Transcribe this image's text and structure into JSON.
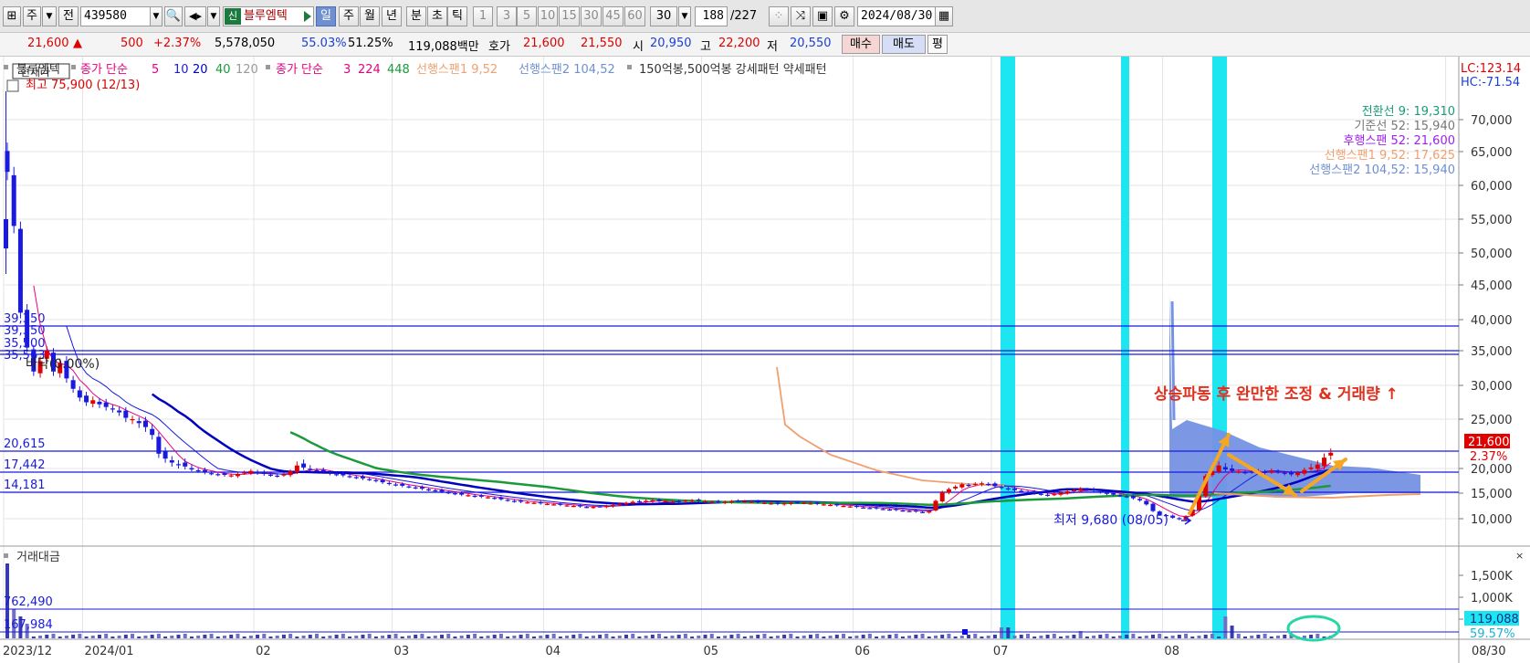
{
  "toolbar": {
    "period_type": "주",
    "prev_label": "전",
    "stock_code": "439580",
    "stock_tag": "신",
    "stock_name": "블루엠텍",
    "periods": [
      "일",
      "주",
      "월",
      "년",
      "분",
      "초",
      "틱"
    ],
    "active_period": "일",
    "intervals": [
      "1",
      "3",
      "5",
      "10",
      "15",
      "30",
      "45",
      "60"
    ],
    "interval_value": "30",
    "count_value": "188",
    "count_total": "/227",
    "date": "2024/08/30"
  },
  "quote": {
    "price": "21,600",
    "arrow": "▲",
    "change": "500",
    "change_pct": "+2.37%",
    "volume": "5,578,050",
    "ratio1": "55.03%",
    "ratio2": "51.25%",
    "amount": "119,088백만",
    "hoga_label": "호가",
    "ask": "21,600",
    "bid": "21,550",
    "open_label": "시",
    "open": "20,950",
    "high_label": "고",
    "high": "22,200",
    "low_label": "저",
    "low": "20,550",
    "buy_label": "매수",
    "sell_label": "매도",
    "eval_label": "평"
  },
  "legend": {
    "name": "블루엠텍",
    "ma_label": "종가 단순",
    "ma_periods": [
      "5",
      "10",
      "20",
      "40",
      "120"
    ],
    "ma2_label": "종가 단순",
    "ma2_periods": [
      "3",
      "224",
      "448"
    ],
    "span1": "선행스팬1 9,52",
    "span2": "선행스팬2 104,52",
    "pattern": "150억봉,500억봉 강세패턴  약세패턴",
    "current_tag": "현재가",
    "max_label": "최고 75,900 (12/13)",
    "lc": "LC:123.14",
    "hc": "HC:-71.54"
  },
  "ichimoku_legend": [
    {
      "text": "전환선 9: 19,310",
      "color": "#1b9a7a"
    },
    {
      "text": "기준선 52: 15,940",
      "color": "#777777"
    },
    {
      "text": "후행스팬 52: 21,600",
      "color": "#a020f0"
    },
    {
      "text": "선행스팬1 9,52: 17,625",
      "color": "#f0a070"
    },
    {
      "text": "선행스팬2 104,52: 15,940",
      "color": "#6f8fd0"
    }
  ],
  "annotations": {
    "main_text": "상승파동 후 완만한 조정 & 거래량 ↑",
    "min_label": "최저 9,680 (08/05)",
    "zero_label": "바닥(0.00%)",
    "current_price": "21,600",
    "current_pct": "2.37%",
    "vol_current": "119,088",
    "vol_pct": "59.57%"
  },
  "h_levels": [
    {
      "value": 39350,
      "label": "39,350",
      "label2": "39,350"
    },
    {
      "value": 35500,
      "label": "35,500",
      "label2": "35,563"
    },
    {
      "value": 20615,
      "label": "20,615"
    },
    {
      "value": 17442,
      "label": "17,442"
    },
    {
      "value": 14181,
      "label": "14,181"
    }
  ],
  "volume_panel": {
    "title": "거래대금",
    "levels": [
      {
        "value": 762490,
        "label": "762,490"
      },
      {
        "value": 167984,
        "label": "167,984"
      }
    ],
    "ticks": [
      "1,500K",
      "1,000K",
      "500K"
    ]
  },
  "chart_data": {
    "type": "candlestick",
    "y_ticks": [
      10000,
      15000,
      20000,
      25000,
      30000,
      35000,
      40000,
      45000,
      50000,
      55000,
      60000,
      65000,
      70000
    ],
    "y_tick_labels": [
      "10,000",
      "15,000",
      "20,000",
      "25,000",
      "30,000",
      "35,000",
      "40,000",
      "45,000",
      "50,000",
      "55,000",
      "60,000",
      "65,000",
      "70,000"
    ],
    "ylim": [
      7500,
      75900
    ],
    "x_labels": [
      {
        "label": "2023/12",
        "index": 0
      },
      {
        "label": "2024/01",
        "index": 12
      },
      {
        "label": "02",
        "index": 38
      },
      {
        "label": "03",
        "index": 59
      },
      {
        "label": "04",
        "index": 82
      },
      {
        "label": "05",
        "index": 106
      },
      {
        "label": "06",
        "index": 129
      },
      {
        "label": "07",
        "index": 150
      },
      {
        "label": "08",
        "index": 176
      },
      {
        "label": "08/30",
        "index": 219
      }
    ],
    "series": [
      {
        "name": "close",
        "values": [
          62000,
          54000,
          41000,
          35500,
          32000,
          33500,
          35000,
          32000,
          33200,
          31000,
          29500,
          28200,
          27500,
          27800,
          27200,
          26800,
          26500,
          26000,
          25200,
          25000,
          24600,
          24200,
          23400,
          21500,
          21000,
          20600,
          20400,
          20200,
          19800,
          19500,
          19200,
          19000,
          18800,
          18700,
          18600,
          18900,
          19200,
          19500,
          19100,
          18900,
          18700,
          18500,
          18800,
          19400,
          20300,
          20100,
          19800,
          19500,
          19300,
          19000,
          18800,
          18600,
          18400,
          18200,
          18000,
          17800,
          17500,
          17200,
          16900,
          16700,
          16500,
          16300,
          16100,
          15900,
          15700,
          15500,
          15300,
          15100,
          14900,
          14700,
          14600,
          14400,
          14300,
          14200,
          14000,
          13800,
          13600,
          13400,
          13300,
          13200,
          13100,
          13000,
          12900,
          12800,
          12700,
          12600,
          12500,
          12400,
          12300,
          12300,
          12400,
          12500,
          12700,
          12900,
          13100,
          13300,
          13400,
          13500,
          13600,
          13500,
          13400,
          13300,
          13400,
          13500,
          13600,
          13500,
          13400,
          13300,
          13200,
          13300,
          13400,
          13500,
          13400,
          13300,
          13200,
          13100,
          13000,
          12900,
          13000,
          13100,
          13200,
          13100,
          13000,
          12900,
          12800,
          12700,
          12600,
          12500,
          12400,
          12300,
          12200,
          12100,
          12000,
          11900,
          11800,
          11700,
          11600,
          11500,
          11400,
          11300,
          11500,
          13500,
          15200,
          15800,
          16300,
          16800,
          16600,
          16900,
          17000,
          16800,
          16400,
          16100,
          15800,
          15600,
          15400,
          15200,
          15000,
          14800,
          14600,
          14800,
          15100,
          15400,
          15600,
          15900,
          15700,
          15500,
          15200,
          14900,
          14700,
          14500,
          14300,
          14000,
          13600,
          12800,
          11500,
          10800,
          10500,
          10200,
          9900,
          10500,
          11800,
          14500,
          18500,
          19500,
          20300,
          19800,
          19500,
          19400,
          19200,
          19300,
          19500,
          19100,
          19600,
          19300,
          19000,
          18800,
          19100,
          19700,
          20100,
          20400,
          21100,
          21600
        ]
      },
      {
        "name": "span2_future",
        "values": []
      }
    ]
  }
}
